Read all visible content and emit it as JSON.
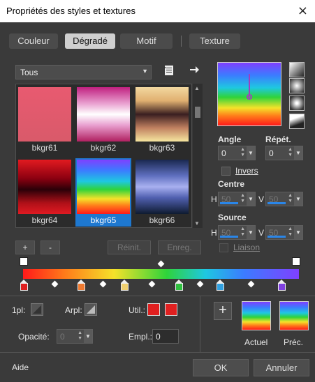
{
  "window": {
    "title": "Propriétés des styles et textures",
    "close_icon": "×"
  },
  "tabs": [
    {
      "label": "Couleur"
    },
    {
      "label": "Dégradé",
      "active": true
    },
    {
      "label": "Motif"
    },
    {
      "label": "Texture"
    }
  ],
  "filter": {
    "selected": "Tous"
  },
  "gallery": {
    "items": [
      {
        "name": "bkgr61"
      },
      {
        "name": "bkgr62"
      },
      {
        "name": "bkgr63"
      },
      {
        "name": "bkgr64"
      },
      {
        "name": "bkgr65",
        "selected": true
      },
      {
        "name": "bkgr66"
      }
    ]
  },
  "gallery_buttons": {
    "add": "+",
    "remove": "-",
    "reset": "Réinit.",
    "save": "Enreg."
  },
  "properties": {
    "angle_label": "Angle",
    "angle_value": "0",
    "repeat_label": "Répét.",
    "repeat_value": "0",
    "invert_label": "Invers",
    "center_label": "Centre",
    "center_h_label": "H",
    "center_h": "50",
    "center_v_label": "V",
    "center_v": "50",
    "source_label": "Source",
    "source_h_label": "H",
    "source_h": "50",
    "source_v_label": "V",
    "source_v": "50",
    "link_label": "Liaison"
  },
  "stops": {
    "colors": [
      "#e02020",
      "#f07a30",
      "#f0d070",
      "#30c040",
      "#30a0e0",
      "#8040e0"
    ]
  },
  "bottom": {
    "first_plan_label": "1pl:",
    "background_label": "Arpl:",
    "use_label": "Util.:",
    "opacity_label": "Opacité:",
    "opacity_value": "0",
    "location_label": "Empl.:",
    "location_value": "0",
    "current_label": "Actuel",
    "previous_label": "Préc.",
    "add_label": "+"
  },
  "footer": {
    "help": "Aide",
    "ok": "OK",
    "cancel": "Annuler"
  }
}
